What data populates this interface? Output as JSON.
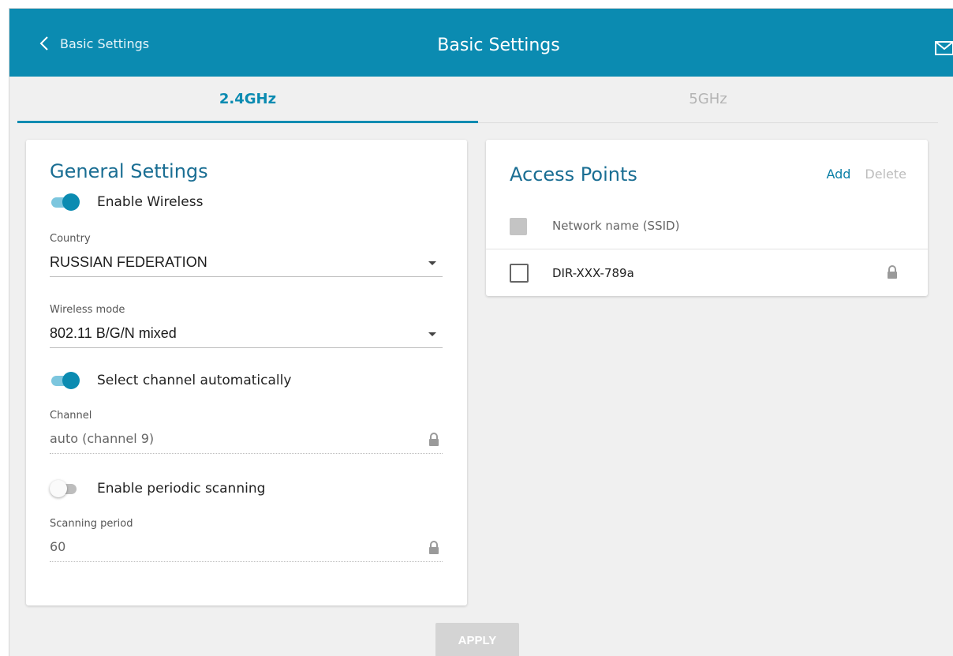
{
  "header": {
    "back_label": "Basic Settings",
    "title": "Basic Settings"
  },
  "tabs": [
    {
      "label": "2.4GHz",
      "active": true
    },
    {
      "label": "5GHz",
      "active": false
    }
  ],
  "general": {
    "title": "General Settings",
    "enable_wireless": {
      "label": "Enable Wireless",
      "on": true
    },
    "country": {
      "label": "Country",
      "value": "RUSSIAN FEDERATION"
    },
    "wireless_mode": {
      "label": "Wireless mode",
      "value": "802.11 B/G/N mixed"
    },
    "auto_channel": {
      "label": "Select channel automatically",
      "on": true
    },
    "channel": {
      "label": "Channel",
      "value": "auto (channel 9)"
    },
    "periodic_scan": {
      "label": "Enable periodic scanning",
      "on": false
    },
    "scan_period": {
      "label": "Scanning period",
      "value": "60"
    }
  },
  "access_points": {
    "title": "Access Points",
    "add_label": "Add",
    "delete_label": "Delete",
    "column_header": "Network name (SSID)",
    "rows": [
      {
        "ssid": "DIR-XXX-789a",
        "checked": false,
        "icon": "lock-icon"
      }
    ]
  },
  "apply_label": "APPLY",
  "icons": {
    "back": "chevron-left-icon",
    "mail": "mail-icon",
    "lock": "lock-icon"
  },
  "colors": {
    "accent": "#0b8bb1",
    "title": "#1a6e93",
    "toggle_track_on": "#7cc6de",
    "apply_disabled": "#d4d4d4"
  }
}
